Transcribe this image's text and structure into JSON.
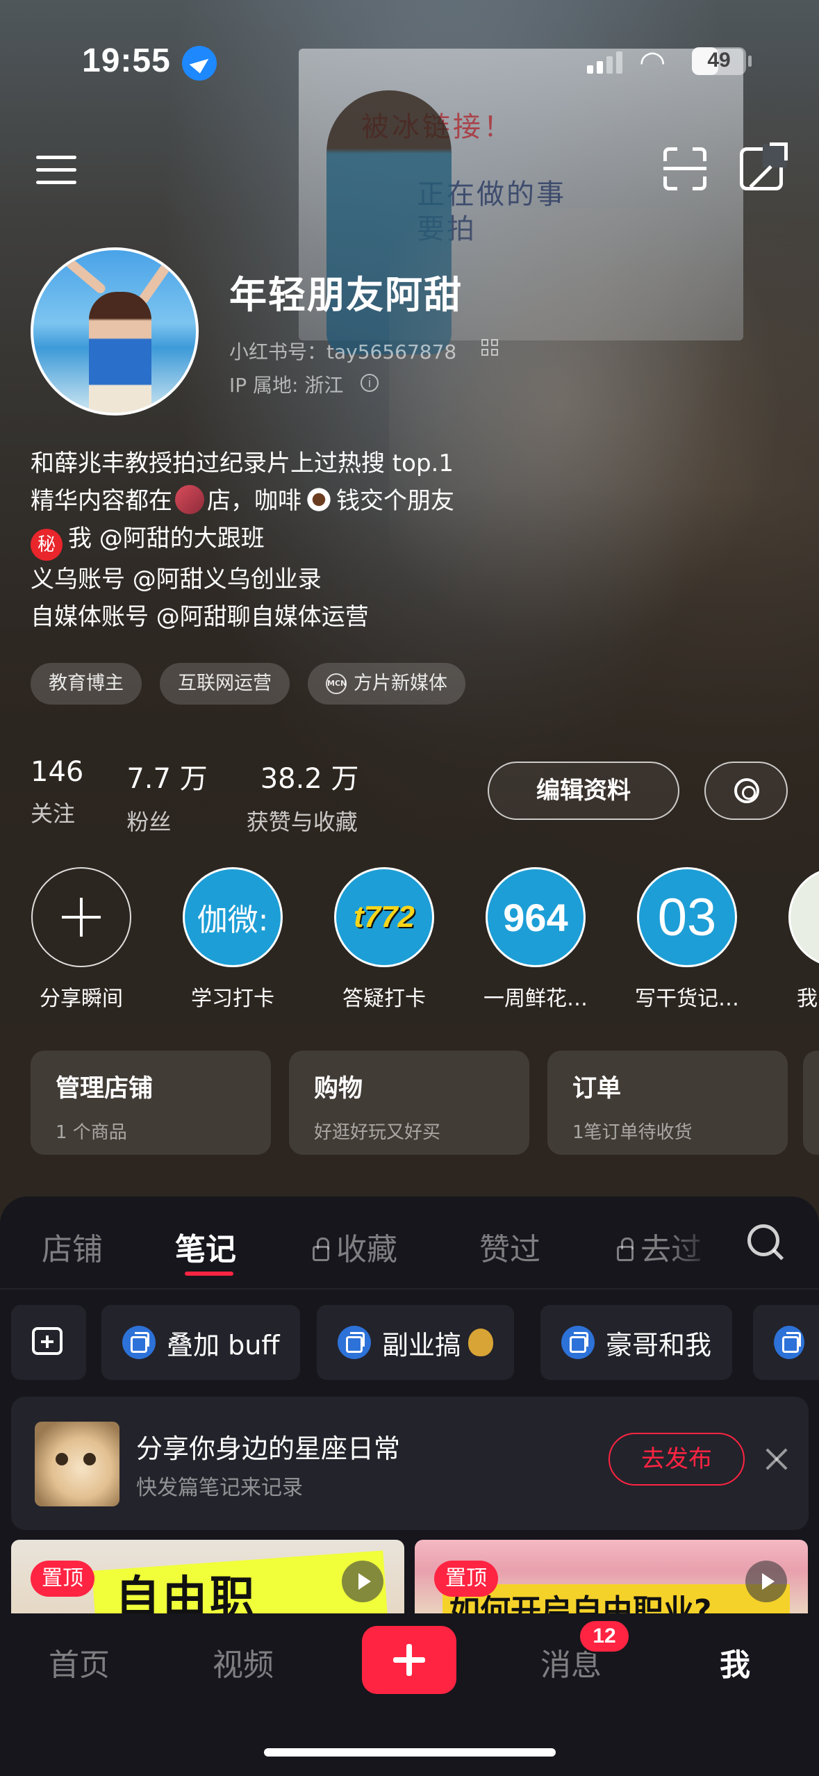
{
  "status_bar": {
    "time": "19:55",
    "battery": "49",
    "battery_level": 0.49
  },
  "profile": {
    "name": "年轻朋友阿甜",
    "id_label": "小红书号：tay56567878",
    "ip_label": "IP 属地: 浙江",
    "bio_lines": [
      "和薛兆丰教授拍过纪录片上过热搜 top.1",
      "精华内容都在",
      "店，咖啡",
      "钱交个朋友",
      "秘",
      "我 @阿甜的大跟班",
      "义乌账号 @阿甜义乌创业录",
      "自媒体账号 @阿甜聊自媒体运营"
    ],
    "tags": [
      "教育博主",
      "互联网运营",
      "MCN",
      "方片新媒体"
    ]
  },
  "stats": [
    {
      "num": "146",
      "label": "关注"
    },
    {
      "num": "7.7 万",
      "label": "粉丝"
    },
    {
      "num": "38.2 万",
      "label": "获赞与收藏"
    }
  ],
  "buttons": {
    "edit": "编辑资料"
  },
  "highlights": [
    {
      "label": "分享瞬间",
      "cover": ""
    },
    {
      "label": "学习打卡",
      "cover": "伽微:"
    },
    {
      "label": "答疑打卡",
      "cover": "t772"
    },
    {
      "label": "一周鲜花…",
      "cover": "964"
    },
    {
      "label": "写干货记…",
      "cover": "03"
    },
    {
      "label": "我",
      "cover": ""
    }
  ],
  "cards": [
    {
      "title": "管理店铺",
      "sub": "1 个商品"
    },
    {
      "title": "购物",
      "sub": "好逛好玩又好买"
    },
    {
      "title": "订单",
      "sub": "1笔订单待收货"
    }
  ],
  "tabs": [
    "店铺",
    "笔记",
    "收藏",
    "赞过",
    "去过"
  ],
  "collections": [
    "叠加 buff",
    "副业搞",
    "豪哥和我"
  ],
  "promo": {
    "title": "分享你身边的星座日常",
    "sub": "快发篇笔记来记录",
    "button": "去发布"
  },
  "notes": [
    {
      "pin": "置顶",
      "title": "自由职"
    },
    {
      "pin": "置顶",
      "title": "如何开启自由职业?"
    }
  ],
  "bottom_nav": {
    "home": "首页",
    "video": "视频",
    "messages": "消息",
    "me": "我",
    "badge": "12"
  },
  "colors": {
    "accent": "#ff2442",
    "highlight_bg": "#1d9ed6",
    "panel_bg": "#16161c"
  }
}
